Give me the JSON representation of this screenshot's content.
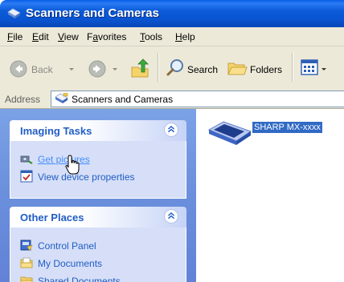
{
  "window": {
    "title": "Scanners and Cameras"
  },
  "menu": [
    {
      "label": "File",
      "accel": "F",
      "rest": "ile"
    },
    {
      "label": "Edit",
      "accel": "E",
      "rest": "dit"
    },
    {
      "label": "View",
      "accel": "V",
      "rest": "iew"
    },
    {
      "label": "Favorites",
      "accel": "a",
      "pre": "F",
      "rest": "vorites"
    },
    {
      "label": "Tools",
      "accel": "T",
      "rest": "ools"
    },
    {
      "label": "Help",
      "accel": "H",
      "rest": "elp"
    }
  ],
  "toolbar": {
    "back_label": "Back",
    "search_label": "Search",
    "folders_label": "Folders"
  },
  "address": {
    "label": "Address",
    "value": "Scanners and Cameras"
  },
  "imaging_tasks": {
    "title": "Imaging Tasks",
    "items": [
      {
        "label": "Get pictures",
        "icon": "camera-scanner-icon"
      },
      {
        "label": "View device properties",
        "icon": "properties-check-icon"
      }
    ]
  },
  "other_places": {
    "title": "Other Places",
    "items": [
      {
        "label": "Control Panel",
        "icon": "control-panel-icon"
      },
      {
        "label": "My Documents",
        "icon": "folder-documents-icon"
      },
      {
        "label": "Shared Documents",
        "icon": "folder-shared-icon"
      }
    ]
  },
  "device": {
    "label": "SHARP MX-xxxx",
    "icon": "scanner-icon"
  },
  "colors": {
    "titlebar": "#0a55d2",
    "taskpane": "#6a8fdc",
    "link": "#215dc6",
    "selection": "#316ac5"
  }
}
